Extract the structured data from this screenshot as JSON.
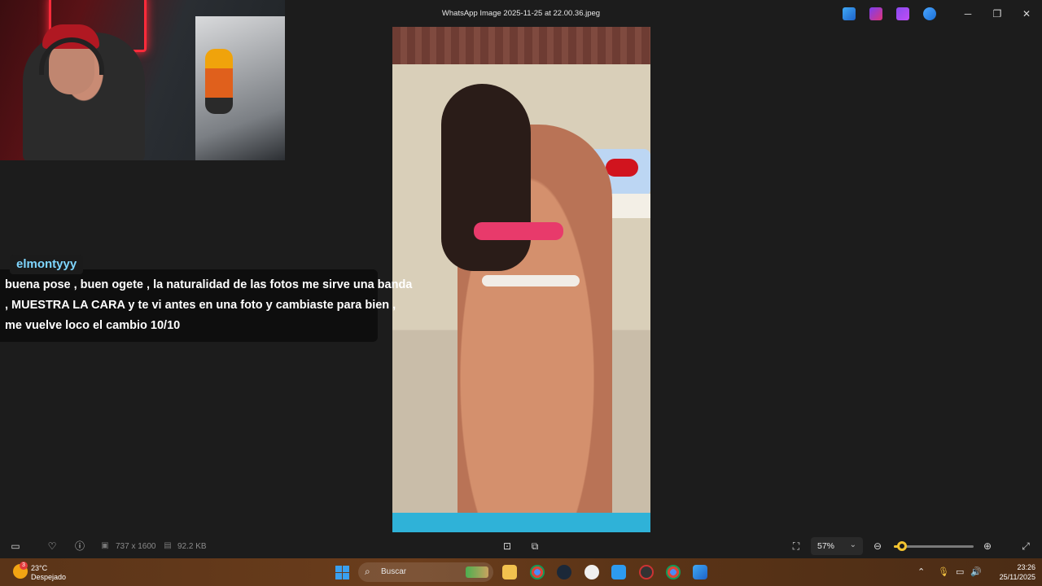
{
  "window": {
    "title": "WhatsApp Image 2025-11-25 at 22.00.36.jpeg",
    "titlebar_apps": [
      "photos-edit-icon",
      "clipchamp-icon",
      "designer-icon",
      "onedrive-icon"
    ],
    "controls": {
      "minimize": "─",
      "restore": "❐",
      "close": "✕"
    }
  },
  "chat": {
    "username": "elmontyyy",
    "lines": [
      "buena pose , buen ogete , la naturalidad de las fotos me sirve una banda",
      ", MUESTRA LA CARA y te vi antes en una foto y cambiaste para bien ,",
      "me vuelve loco el cambio 10/10"
    ]
  },
  "toolbar": {
    "dimensions": "737 x 1600",
    "filesize": "92.2 KB",
    "zoom": "57%",
    "zoom_level": 0.1
  },
  "taskbar": {
    "weather_temp": "23°C",
    "weather_desc": "Despejado",
    "weather_badge": "3",
    "search_placeholder": "Buscar",
    "time": "23:26",
    "date": "25/11/2025",
    "accent": "#f4c430"
  }
}
